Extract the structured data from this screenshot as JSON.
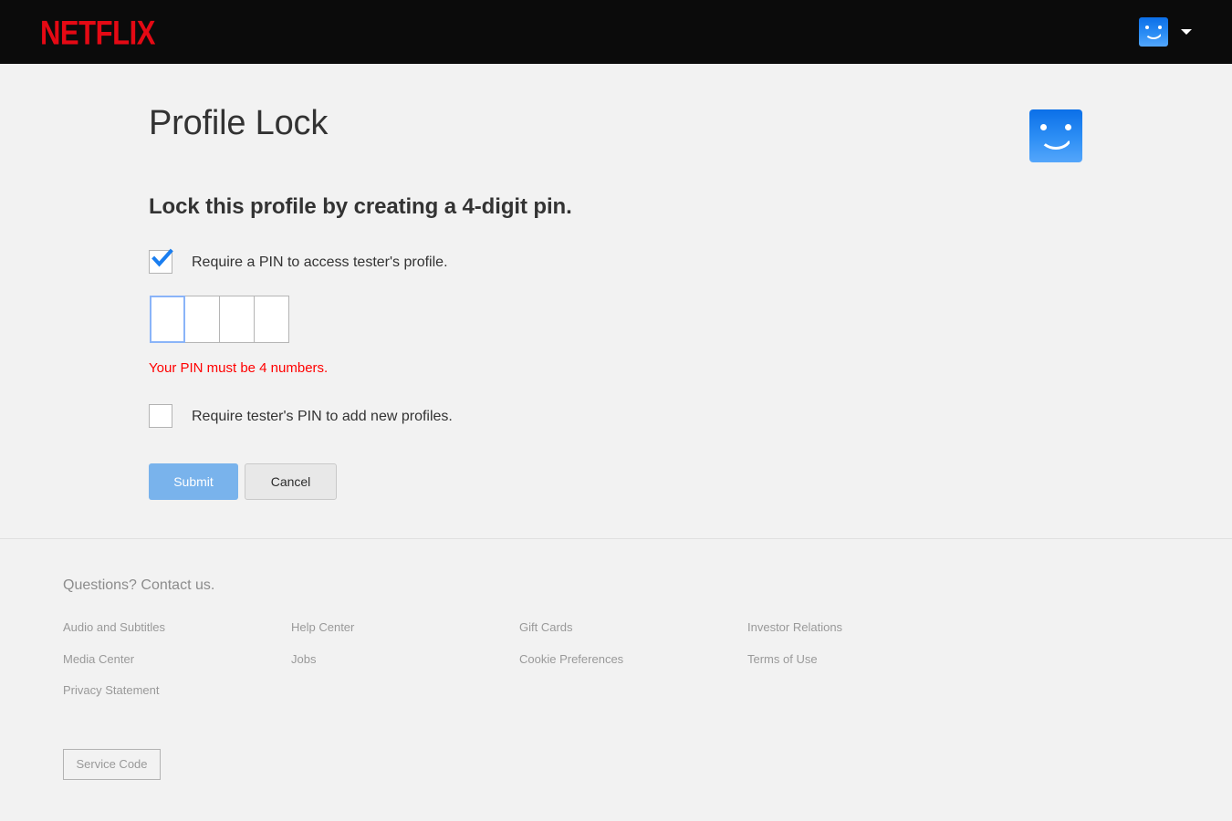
{
  "header": {
    "brand": "NETFLIX",
    "brand_color": "#e50914",
    "background_color": "#0b0b0b",
    "avatar_icon": "profile-avatar-smiley-icon",
    "caret_icon": "chevron-down-icon"
  },
  "main": {
    "page_title": "Profile Lock",
    "profile_avatar_icon": "profile-avatar-smiley-icon",
    "subheading": "Lock this profile by creating a 4-digit pin.",
    "require_pin_checkbox": {
      "label": "Require a PIN to access tester's profile.",
      "checked": true,
      "check_color": "#1a7ef0"
    },
    "pin_inputs": {
      "values": [
        "",
        "",
        "",
        ""
      ],
      "focused_index": 0,
      "focus_color": "#8ab4f8"
    },
    "error_message": "Your PIN must be 4 numbers.",
    "error_color": "#ff0000",
    "require_pin_new_profiles_checkbox": {
      "label": "Require tester's PIN to add new profiles.",
      "checked": false
    },
    "submit_label": "Submit",
    "submit_color": "#79b3ec",
    "cancel_label": "Cancel"
  },
  "footer": {
    "heading": "Questions? Contact us.",
    "columns": [
      {
        "links": [
          "Audio and Subtitles",
          "Media Center",
          "Privacy Statement"
        ]
      },
      {
        "links": [
          "Help Center",
          "Jobs"
        ]
      },
      {
        "links": [
          "Gift Cards",
          "Cookie Preferences"
        ]
      },
      {
        "links": [
          "Investor Relations",
          "Terms of Use"
        ]
      }
    ],
    "service_code_label": "Service Code"
  }
}
